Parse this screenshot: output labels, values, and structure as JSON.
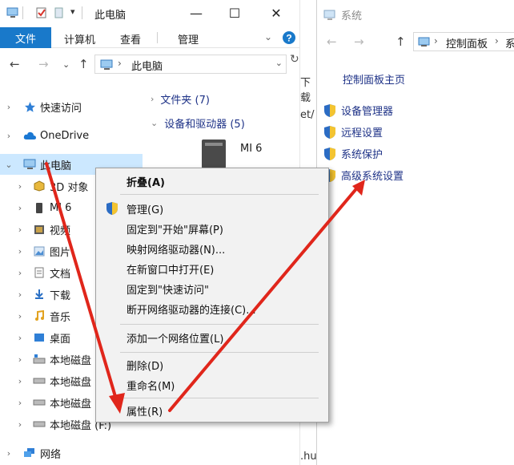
{
  "explorer": {
    "title": "此电脑",
    "ribbon_tabs": {
      "file": "文件",
      "computer": "计算机",
      "view": "查看",
      "manage": "管理"
    },
    "address": {
      "crumb": "此电脑"
    },
    "nav": {
      "quick_access": "快速访问",
      "onedrive": "OneDrive",
      "this_pc": "此电脑",
      "objects_3d": "3D 对象",
      "mi6": "MI 6",
      "videos": "视频",
      "pictures": "图片",
      "documents": "文档",
      "downloads": "下载",
      "music": "音乐",
      "desktop": "桌面",
      "disk_c": "本地磁盘 (",
      "disk_d": "本地磁盘 (",
      "disk_e": "本地磁盘 (",
      "disk_f": "本地磁盘 (F:)",
      "network": "网络"
    },
    "content": {
      "folders_group": "文件夹 (7)",
      "devices_group": "设备和驱动器 (5)",
      "device_label": "MI 6"
    }
  },
  "context_menu": {
    "collapse": "折叠(A)",
    "manage": "管理(G)",
    "pin_start": "固定到\"开始\"屏幕(P)",
    "map_drive": "映射网络驱动器(N)...",
    "open_new_window": "在新窗口中打开(E)",
    "pin_quick": "固定到\"快速访问\"",
    "disconnect_drive": "断开网络驱动器的连接(C)...",
    "add_network_location": "添加一个网络位置(L)",
    "delete": "删除(D)",
    "rename": "重命名(M)",
    "properties": "属性(R)"
  },
  "background_strip": {
    "a": "下载",
    "b": "et/",
    "c": ".hu"
  },
  "system": {
    "title": "系统",
    "address_crumb": "控制面板",
    "address_more": "系",
    "home_link": "控制面板主页",
    "links": [
      "设备管理器",
      "远程设置",
      "系统保护",
      "高级系统设置"
    ]
  },
  "colors": {
    "accent": "#1979ca",
    "link": "#1e3287",
    "arrow": "#e0261b",
    "selection": "#cce8ff"
  }
}
